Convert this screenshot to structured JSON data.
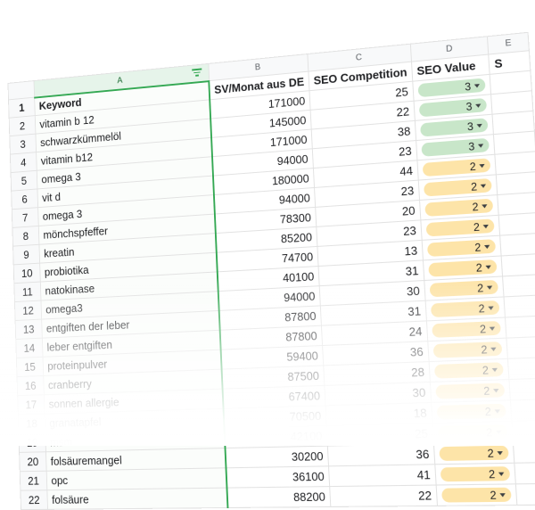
{
  "columns": [
    {
      "letter": "A"
    },
    {
      "letter": "B"
    },
    {
      "letter": "C"
    },
    {
      "letter": "D"
    },
    {
      "letter": "E"
    }
  ],
  "header_row": {
    "row_number": "1",
    "keyword": "Keyword",
    "sv": "SV/Monat aus DE",
    "competition": "SEO Competition",
    "value": "SEO Value",
    "next_col_partial": "S"
  },
  "chip_colors": {
    "3": "#c8e6c9",
    "2": "#fde4a8"
  },
  "rows": [
    {
      "n": "2",
      "keyword": "vitamin b 12",
      "sv": "171000",
      "competition": "25",
      "value": "3"
    },
    {
      "n": "3",
      "keyword": "schwarzkümmelöl",
      "sv": "145000",
      "competition": "22",
      "value": "3"
    },
    {
      "n": "4",
      "keyword": "vitamin b12",
      "sv": "171000",
      "competition": "38",
      "value": "3"
    },
    {
      "n": "5",
      "keyword": "omega 3",
      "sv": "94000",
      "competition": "23",
      "value": "3"
    },
    {
      "n": "6",
      "keyword": "vit d",
      "sv": "180000",
      "competition": "44",
      "value": "2"
    },
    {
      "n": "7",
      "keyword": "omega 3",
      "sv": "94000",
      "competition": "23",
      "value": "2"
    },
    {
      "n": "8",
      "keyword": "mönchspfeffer",
      "sv": "78300",
      "competition": "20",
      "value": "2"
    },
    {
      "n": "9",
      "keyword": "kreatin",
      "sv": "85200",
      "competition": "23",
      "value": "2"
    },
    {
      "n": "10",
      "keyword": "probiotika",
      "sv": "74700",
      "competition": "13",
      "value": "2"
    },
    {
      "n": "11",
      "keyword": "natokinase",
      "sv": "40100",
      "competition": "31",
      "value": "2"
    },
    {
      "n": "12",
      "keyword": "omega3",
      "sv": "94000",
      "competition": "30",
      "value": "2"
    },
    {
      "n": "13",
      "keyword": "entgiften der leber",
      "sv": "87800",
      "competition": "31",
      "value": "2"
    },
    {
      "n": "14",
      "keyword": "leber entgiften",
      "sv": "87800",
      "competition": "24",
      "value": "2"
    },
    {
      "n": "15",
      "keyword": "proteinpulver",
      "sv": "59400",
      "competition": "36",
      "value": "2"
    },
    {
      "n": "16",
      "keyword": "cranberry",
      "sv": "87500",
      "competition": "28",
      "value": "2"
    },
    {
      "n": "17",
      "keyword": "sonnen allergie",
      "sv": "67400",
      "competition": "30",
      "value": "2"
    },
    {
      "n": "18",
      "keyword": "granatapfel",
      "sv": "70500",
      "competition": "18",
      "value": "2"
    },
    {
      "n": "19",
      "keyword": "msm",
      "sv": "42100",
      "competition": "25",
      "value": "2"
    },
    {
      "n": "20",
      "keyword": "folsäuremangel",
      "sv": "30200",
      "competition": "36",
      "value": "2"
    },
    {
      "n": "21",
      "keyword": "opc",
      "sv": "36100",
      "competition": "41",
      "value": "2"
    },
    {
      "n": "22",
      "keyword": "folsäure",
      "sv": "88200",
      "competition": "22",
      "value": "2"
    }
  ]
}
